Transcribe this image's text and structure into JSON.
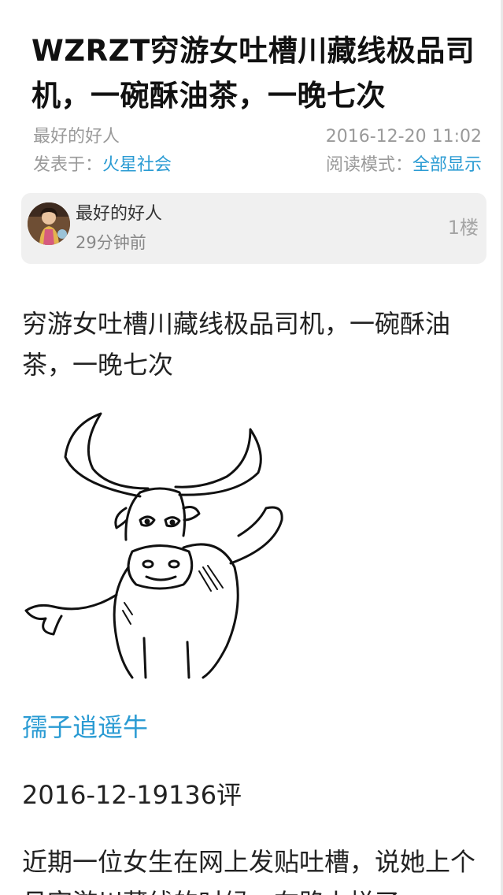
{
  "article": {
    "title": "WZRZT穷游女吐槽川藏线极品司机，一碗酥油茶，一晚七次",
    "author": "最好的好人",
    "timestamp": "2016-12-20 11:02",
    "posted_in_label": "发表于：",
    "category": "火星社会",
    "read_mode_label": "阅读模式：",
    "read_mode_value": "全部显示"
  },
  "post": {
    "author_name": "最好的好人",
    "relative_time": "29分钟前",
    "floor": "1楼",
    "content_title": "穷游女吐槽川藏线极品司机，一碗酥油茶，一晚七次",
    "source_name": "孺子逍遥牛",
    "date_comments": "2016-12-19136评",
    "body_text": "近期一位女生在网上发贴吐槽，说她上个月穷游川藏线的时候，在路上拦了"
  },
  "icons": {
    "avatar": "avatar-photo",
    "post_image": "bull-cartoon-illustration"
  },
  "colors": {
    "link": "#2a9bd3",
    "meta_text": "#9a9a9a",
    "author_box_bg": "#f0f0f0"
  }
}
